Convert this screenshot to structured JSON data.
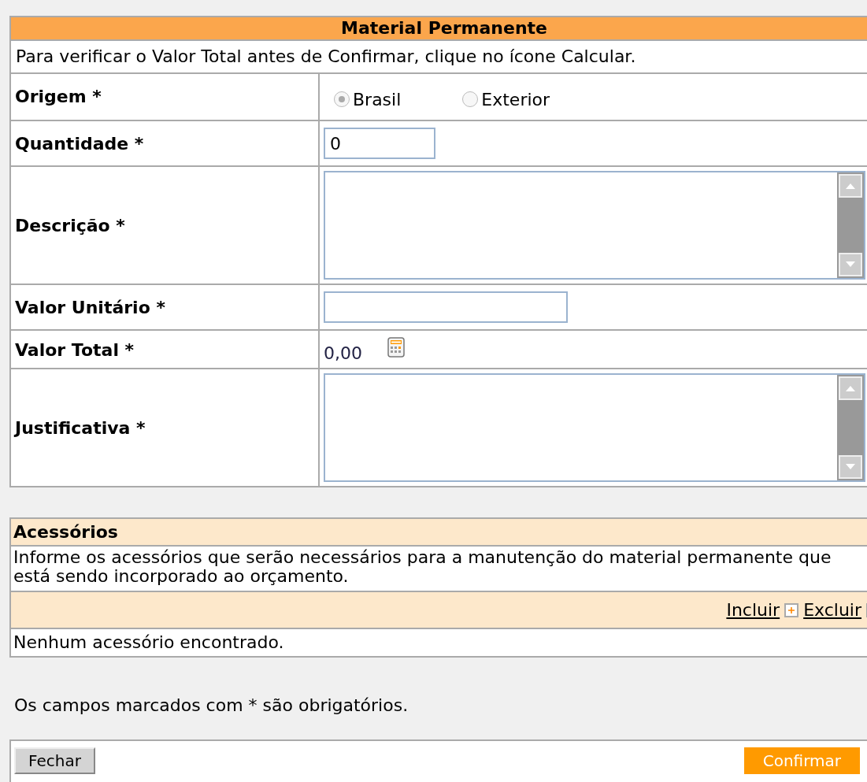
{
  "panel": {
    "title": "Material Permanente",
    "note": "Para verificar o Valor Total antes de Confirmar, clique no ícone Calcular."
  },
  "fields": [
    {
      "kind": "radio",
      "label": "Origem *",
      "options": [
        {
          "label": "Brasil",
          "selected": true
        },
        {
          "label": "Exterior",
          "selected": false
        }
      ]
    },
    {
      "kind": "number",
      "label": "Quantidade *",
      "value": "0"
    },
    {
      "kind": "textarea",
      "label": "Descrição *"
    },
    {
      "kind": "text",
      "label": "Valor Unitário *"
    },
    {
      "kind": "total",
      "label": "Valor Total *",
      "value": "0,00"
    },
    {
      "kind": "textarea",
      "label": "Justificativa *"
    }
  ],
  "accessories": {
    "title": "Acessórios",
    "description": "Informe os acessórios que serão necessários para a manutenção do material permanente que está sendo incorporado ao orçamento.",
    "actions": [
      "Incluir",
      "Excluir"
    ],
    "empty": "Nenhum acessório encontrado."
  },
  "required_note": "Os campos marcados com * são obrigatórios.",
  "buttons": {
    "close": "Fechar",
    "confirm": "Confirmar"
  }
}
